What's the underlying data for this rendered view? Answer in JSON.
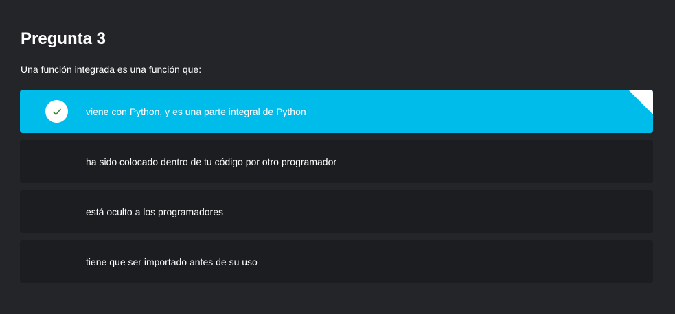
{
  "question": {
    "title": "Pregunta 3",
    "prompt": "Una función integrada es una función que:"
  },
  "options": [
    {
      "label": "viene con Python, y es una parte integral de Python",
      "selected": true
    },
    {
      "label": "ha sido colocado dentro de tu código por otro programador",
      "selected": false
    },
    {
      "label": "está oculto a los programadores",
      "selected": false
    },
    {
      "label": "tiene que ser importado antes de su uso",
      "selected": false
    }
  ],
  "colors": {
    "background": "#242528",
    "option_background": "#1c1d20",
    "selected_accent": "#00bceb",
    "check_color": "#2e8b2e"
  },
  "icons": {
    "selected_marker": "checkmark-icon",
    "corner_marker": "corner-fold-icon"
  }
}
